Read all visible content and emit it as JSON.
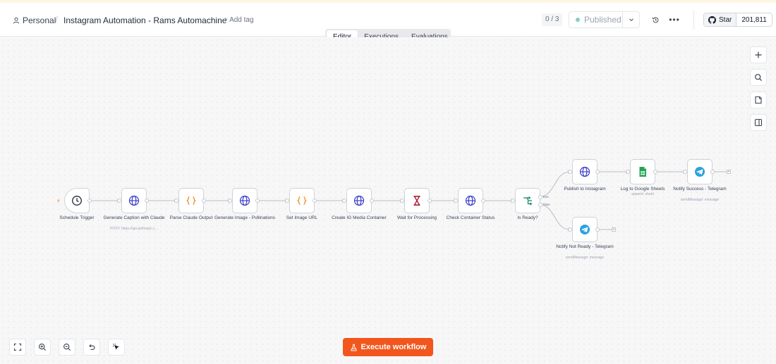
{
  "header": {
    "project": "Personal",
    "workflow_title": "Instagram Automation - Rams Automachine",
    "add_tag": "+ Add tag",
    "step_counter": "0 / 3",
    "publish_status": "Published",
    "github_star": "Star",
    "github_count": "201,811"
  },
  "tabs": [
    {
      "label": "Editor",
      "active": true
    },
    {
      "label": "Executions",
      "active": false
    },
    {
      "label": "Evaluations",
      "active": false
    }
  ],
  "nodes": [
    {
      "label": "Schedule Trigger",
      "sub": "",
      "icon": "clock-icon"
    },
    {
      "label": "Generate Caption with Claude",
      "sub": "POST: https://api.anthropic.c...",
      "icon": "globe-icon"
    },
    {
      "label": "Parse Claude Output",
      "sub": "",
      "icon": "code-braces-icon"
    },
    {
      "label": "Generate Image - Pollinations",
      "sub": "",
      "icon": "globe-icon"
    },
    {
      "label": "Set Image URL",
      "sub": "",
      "icon": "code-braces-icon"
    },
    {
      "label": "Create IG Media Container",
      "sub": "",
      "icon": "globe-icon"
    },
    {
      "label": "Wait for Processing",
      "sub": "",
      "icon": "hourglass-icon"
    },
    {
      "label": "Check Container Status",
      "sub": "",
      "icon": "globe-icon"
    },
    {
      "label": "Is Ready?",
      "sub": "",
      "icon": "branch-icon"
    },
    {
      "label": "Publish to Instagram",
      "sub": "",
      "icon": "globe-icon"
    },
    {
      "label": "Log to Google Sheets",
      "sub": "append: sheet",
      "icon": "google-sheets-icon"
    },
    {
      "label": "Notify Success - Telegram",
      "sub": "sendMessage: message",
      "icon": "telegram-icon"
    },
    {
      "label": "Notify Not Ready - Telegram",
      "sub": "sendMessage: message",
      "icon": "telegram-icon"
    }
  ],
  "branch_labels": {
    "true": "true",
    "false": "false"
  },
  "footer": {
    "execute_label": "Execute workflow"
  },
  "colors": {
    "accent": "#f2561d",
    "globe": "#3b3ec9",
    "code": "#f08a24",
    "wait": "#a8102f",
    "branch": "#1b8a6b",
    "sheets": "#22a454",
    "telegram": "#2aa3dc",
    "published_dot": "#84cfc3"
  }
}
